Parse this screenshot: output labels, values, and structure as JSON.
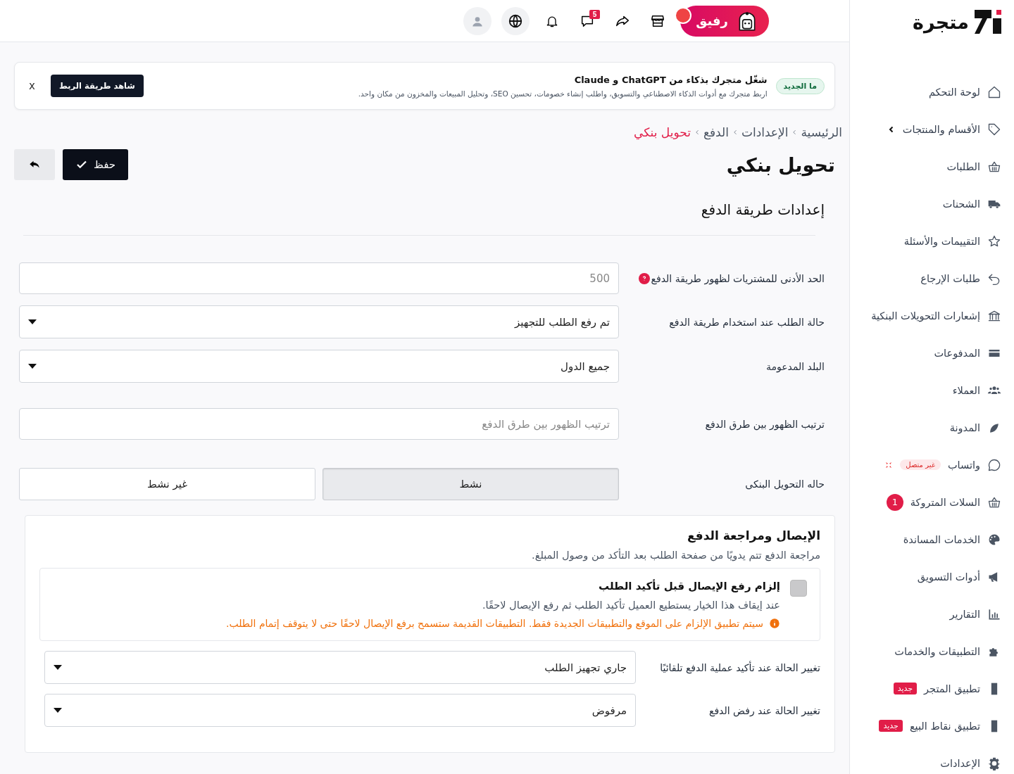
{
  "topbar": {
    "assistant": {
      "label": "رفيق"
    },
    "messages_badge": "5"
  },
  "banner": {
    "tag": "ما الجديد",
    "title": "شغّل متجرك بذكاء من ChatGPT و Claude",
    "text": "اربط متجرك مع أدوات الذكاء الاصطناعي والتسويق، واطلب إنشاء خصومات، تحسين SEO، وتحليل المبيعات والمخزون من مكان واحد.",
    "button": "شاهد طريقة الربط",
    "close": "x"
  },
  "breadcrumb": [
    {
      "label": "الرئيسية",
      "selected": false
    },
    {
      "label": "الإعدادات",
      "selected": false
    },
    {
      "label": "الدفع",
      "selected": false
    },
    {
      "label": "تحويل بنكي",
      "selected": true
    }
  ],
  "page_title": "تحويل بنكي",
  "save_button": "حفظ",
  "section_title": "إعدادات طريقة الدفع",
  "fields": [
    {
      "kind": "input",
      "label": "الحد الأدنى للمشتريات لظهور طريقة الدفع",
      "help": true,
      "placeholder": "500"
    },
    {
      "kind": "select",
      "label": "حالة الطلب عند استخدام طريقة الدفع",
      "value": "تم رفع الطلب للتجهيز"
    },
    {
      "kind": "select",
      "label": "البلد المدعومة",
      "value": "جميع الدول"
    },
    {
      "kind": "input",
      "label": "ترتيب الظهور بين طرق الدفع",
      "placeholder": "ترتيب الظهور بين طرق الدفع"
    },
    {
      "kind": "segmented",
      "label": "حاله التحويل البنكى",
      "options": [
        {
          "label": "نشط",
          "selected": true
        },
        {
          "label": "غير نشط",
          "selected": false
        }
      ]
    }
  ],
  "receipt": {
    "title": "الإيصال ومراجعة الدفع",
    "subtitle": "مراجعة الدفع تتم يدويًا من صفحة الطلب بعد التأكد من وصول المبلغ.",
    "option": {
      "checked": false,
      "title": "إلزام رفع الإيصال قبل تأكيد الطلب",
      "description": "عند إيقاف هذا الخيار يستطيع العميل تأكيد الطلب ثم رفع الإيصال لاحقًا.",
      "warning": "سيتم تطبيق الإلزام على الموقع والتطبيقات الجديدة فقط. التطبيقات القديمة ستسمح برفع الإيصال لاحقًا حتى لا يتوقف إتمام الطلب."
    },
    "selects": [
      {
        "label": "تغيير الحالة عند تأكيد عملية الدفع تلقائيًا",
        "value": "جاري تجهيز الطلب"
      },
      {
        "label": "تغيير الحالة عند رفض الدفع",
        "value": "مرفوض"
      }
    ]
  },
  "sidebar": {
    "logo": "متجرة",
    "items": [
      {
        "label": "لوحة التحكم"
      },
      {
        "label": "الأقسام والمنتجات",
        "expandable": true
      },
      {
        "label": "الطلبات"
      },
      {
        "label": "الشحنات"
      },
      {
        "label": "التقييمات والأسئلة"
      },
      {
        "label": "طلبات الإرجاع"
      },
      {
        "label": "إشعارات التحويلات البنكية"
      },
      {
        "label": "المدفوعات"
      },
      {
        "label": "العملاء"
      },
      {
        "label": "المدونة"
      },
      {
        "label": "واتساب",
        "badge": {
          "kind": "status",
          "text": "غير متصل"
        }
      },
      {
        "label": "السلات المتروكة",
        "badge": {
          "kind": "count",
          "text": "1"
        }
      },
      {
        "label": "الخدمات المساندة"
      },
      {
        "label": "أدوات التسويق"
      },
      {
        "label": "التقارير"
      },
      {
        "label": "التطبيقات والخدمات"
      },
      {
        "label": "تطبيق المتجر",
        "badge": {
          "kind": "new",
          "text": "جديد"
        }
      },
      {
        "label": "تطبيق نقاط البيع",
        "badge": {
          "kind": "new",
          "text": "جديد"
        }
      },
      {
        "label": "الإعدادات"
      }
    ]
  }
}
